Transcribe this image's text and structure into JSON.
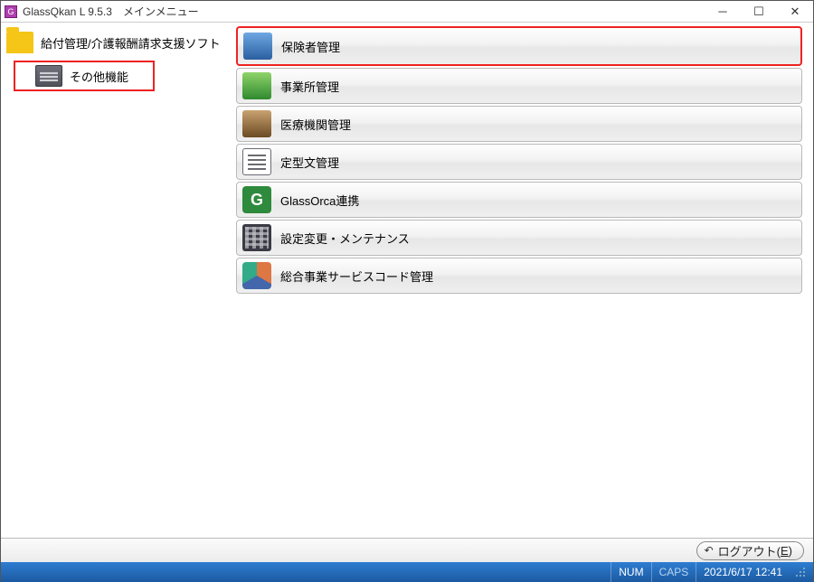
{
  "window": {
    "title": "GlassQkan L 9.5.3　メインメニュー",
    "app_icon_glyph": "G"
  },
  "tree": {
    "root_label": "給付管理/介護報酬請求支援ソフト",
    "child_label": "その他機能"
  },
  "menu": {
    "items": [
      {
        "label": "保険者管理"
      },
      {
        "label": "事業所管理"
      },
      {
        "label": "医療機関管理"
      },
      {
        "label": "定型文管理"
      },
      {
        "label": "GlassOrca連携"
      },
      {
        "label": "設定変更・メンテナンス"
      },
      {
        "label": "総合事業サービスコード管理"
      }
    ]
  },
  "footer": {
    "logout_label": "ログアウト(",
    "logout_key": "E",
    "logout_suffix": ")"
  },
  "status": {
    "num": "NUM",
    "caps": "CAPS",
    "datetime": "2021/6/17 12:41"
  }
}
